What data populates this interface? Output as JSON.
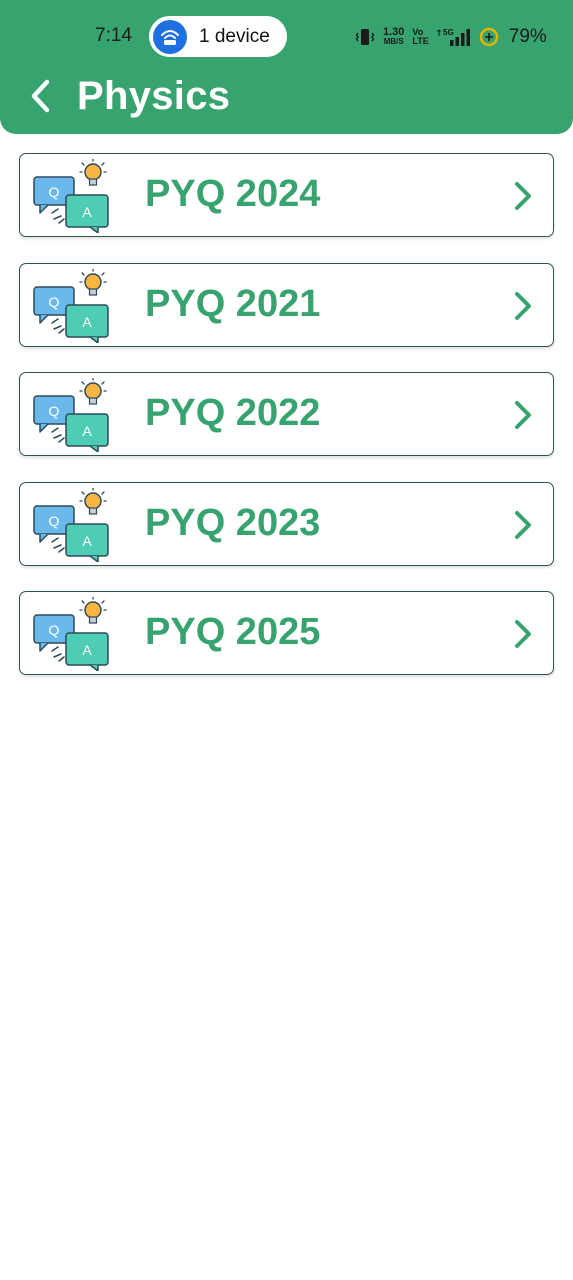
{
  "status_bar": {
    "time": "7:14",
    "hotspot_label": "1 device",
    "net_speed_value": "1.30",
    "net_speed_unit": "MB/S",
    "volte_top": "Vo",
    "volte_bottom": "LTE",
    "network_type": "5G",
    "battery_percent": "79%"
  },
  "header": {
    "title": "Physics",
    "back_icon": "chevron-left-icon",
    "background_color": "#37a36f"
  },
  "items": [
    {
      "label": "PYQ 2024",
      "icon": "qa-bulb-icon"
    },
    {
      "label": "PYQ 2021",
      "icon": "qa-bulb-icon"
    },
    {
      "label": "PYQ 2022",
      "icon": "qa-bulb-icon"
    },
    {
      "label": "PYQ 2023",
      "icon": "qa-bulb-icon"
    },
    {
      "label": "PYQ 2025",
      "icon": "qa-bulb-icon"
    }
  ],
  "colors": {
    "accent": "#37a36f",
    "card_border": "#2a5a45"
  }
}
